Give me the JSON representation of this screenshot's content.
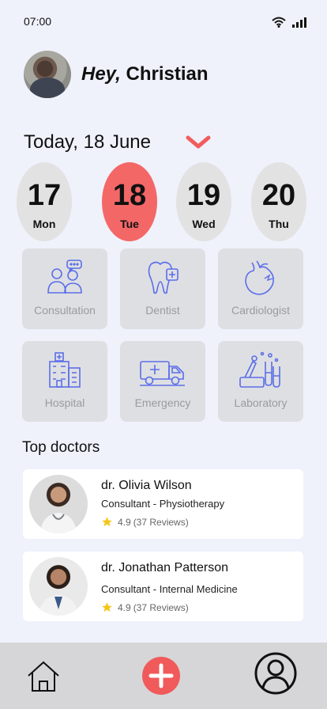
{
  "status_bar": {
    "time": "07:00",
    "wifi_icon": "wifi-icon",
    "signal_icon": "signal-icon"
  },
  "header": {
    "greeting_prefix": "Hey,",
    "user_name": "Christian"
  },
  "date_header": {
    "title": "Today, 18 June",
    "chevron_icon": "chevron-down-icon"
  },
  "days": [
    {
      "number": "17",
      "name": "Mon",
      "selected": false
    },
    {
      "number": "18",
      "name": "Tue",
      "selected": true
    },
    {
      "number": "19",
      "name": "Wed",
      "selected": false
    },
    {
      "number": "20",
      "name": "Thu",
      "selected": false
    }
  ],
  "categories": [
    {
      "label": "Consultation",
      "icon": "consultation-icon"
    },
    {
      "label": "Dentist",
      "icon": "tooth-icon"
    },
    {
      "label": "Cardiologist",
      "icon": "heart-icon"
    },
    {
      "label": "Hospital",
      "icon": "hospital-icon"
    },
    {
      "label": "Emergency",
      "icon": "ambulance-icon"
    },
    {
      "label": "Laboratory",
      "icon": "lab-icon"
    }
  ],
  "top_doctors": {
    "title": "Top doctors",
    "doctors": [
      {
        "name": "dr. Olivia Wilson",
        "specialty": "Consultant - Physiotherapy",
        "rating": "4.9",
        "reviews": "(37 Reviews)"
      },
      {
        "name": "dr. Jonathan Patterson",
        "specialty": "Consultant - Internal Medicine",
        "rating": "4.9",
        "reviews": "(37 Reviews)"
      }
    ]
  },
  "bottom_nav": {
    "home_icon": "home-icon",
    "add_icon": "plus-icon",
    "profile_icon": "profile-icon"
  },
  "colors": {
    "accent": "#f46767",
    "icon_blue": "#5b6ee8",
    "background": "#eff2fb",
    "card": "#dedfe3"
  }
}
